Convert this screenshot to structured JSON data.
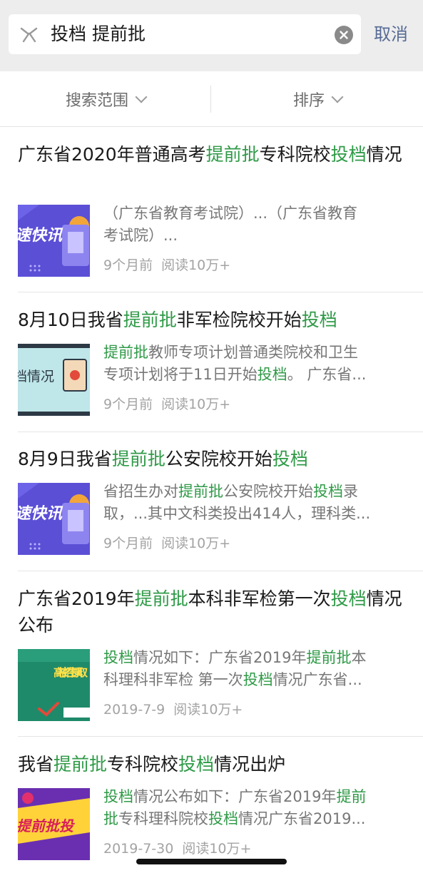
{
  "search": {
    "query": "投档 提前批",
    "cancel_label": "取消",
    "logo_icon": "search-logo-icon",
    "clear_icon": "clear-icon"
  },
  "filters": {
    "scope_label": "搜索范围",
    "sort_label": "排序"
  },
  "colors": {
    "highlight": "#2f9a47",
    "cancel": "#576b95",
    "top_bar_bg": "#ededed"
  },
  "results": [
    {
      "title": [
        "广东省2020年普通高考",
        {
          "hl": "提前批"
        },
        "专科院校",
        {
          "hl": "投档"
        },
        "情况"
      ],
      "snippet_lines": [
        [
          "（广东省教育考试院）...（广东省教育"
        ],
        [
          "考试院）..."
        ]
      ],
      "time": "9个月前",
      "reads": "阅读10万+",
      "thumb_text": "速快讯"
    },
    {
      "title": [
        "8月10日我省",
        {
          "hl": "提前批"
        },
        "非军检院校开始",
        {
          "hl": "投档"
        }
      ],
      "snippet_lines": [
        [
          {
            "hl": "提前批"
          },
          "教师专项计划普通类院校和卫生"
        ],
        [
          "专项计划将于11日开始",
          {
            "hl": "投档"
          },
          "。 广东省..."
        ]
      ],
      "time": "9个月前",
      "reads": "阅读10万+",
      "thumb_text": "档情况"
    },
    {
      "title": [
        "8月9日我省",
        {
          "hl": "提前批"
        },
        "公安院校开始",
        {
          "hl": "投档"
        }
      ],
      "snippet_lines": [
        [
          "省招生办对",
          {
            "hl": "提前批"
          },
          "公安院校开始",
          {
            "hl": "投档"
          },
          "录"
        ],
        [
          "取，...其中文科类投出414人，理科类..."
        ]
      ],
      "time": "9个月前",
      "reads": "阅读10万+",
      "thumb_text": "速快讯"
    },
    {
      "title": [
        "广东省2019年",
        {
          "hl": "提前批"
        },
        "本科非军检第一次",
        {
          "hl": "投档"
        },
        "情况公布"
      ],
      "snippet_lines": [
        [
          {
            "hl": "投档"
          },
          "情况如下：广东省2019年",
          {
            "hl": "提前批"
          },
          "本"
        ],
        [
          "科理科非军检 第一次",
          {
            "hl": "投档"
          },
          "情况广东省..."
        ]
      ],
      "time": "2019-7-9",
      "reads": "阅读10万+",
      "thumb_text": "高校招生录取"
    },
    {
      "title": [
        "我省",
        {
          "hl": "提前批"
        },
        "专科院校",
        {
          "hl": "投档"
        },
        "情况出炉"
      ],
      "snippet_lines": [
        [
          {
            "hl": "投档"
          },
          "情况公布如下：广东省2019年",
          {
            "hl": "提前"
          }
        ],
        [
          {
            "hl": "批"
          },
          "专科理科院校",
          {
            "hl": "投档"
          },
          "情况广东省2019..."
        ]
      ],
      "time": "2019-7-30",
      "reads": "阅读10万+",
      "thumb_text": "提前批投"
    }
  ]
}
